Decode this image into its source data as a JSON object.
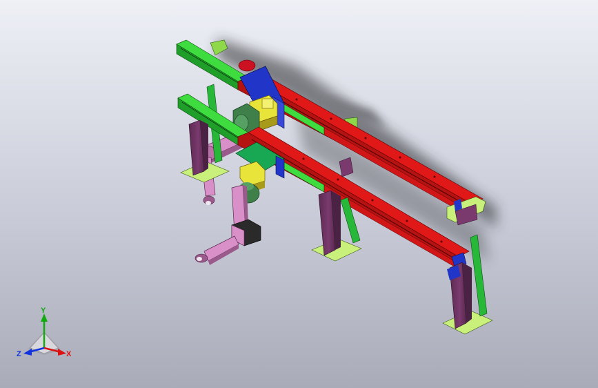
{
  "view": {
    "background_top": "#eef0f6",
    "background_bottom": "#a9abb8"
  },
  "model": {
    "name": "",
    "part_colors": {
      "rail_top": "#e01818",
      "rail_side": "#b51212",
      "rail_green": "#3fdc3f",
      "rail_green_dark": "#1f9f2a",
      "leg": "#7a3a6e",
      "leg_dark": "#4a2244",
      "base_plate": "#c8f07a",
      "brace": "#27b83a",
      "motor": "#e8e43a",
      "motor_dark": "#a89a1a",
      "carriage_blue": "#2136c8",
      "carriage_plate": "#18a854",
      "robot_green": "#3e7f4a",
      "robot_arm": "#d98fc8",
      "robot_arm_dark": "#9a5a8c",
      "red_cap": "#cc1122"
    }
  },
  "triad": {
    "x_label": "X",
    "y_label": "Y",
    "z_label": "Z",
    "x_color": "#dd1111",
    "y_color": "#11aa11",
    "z_color": "#1133dd"
  }
}
